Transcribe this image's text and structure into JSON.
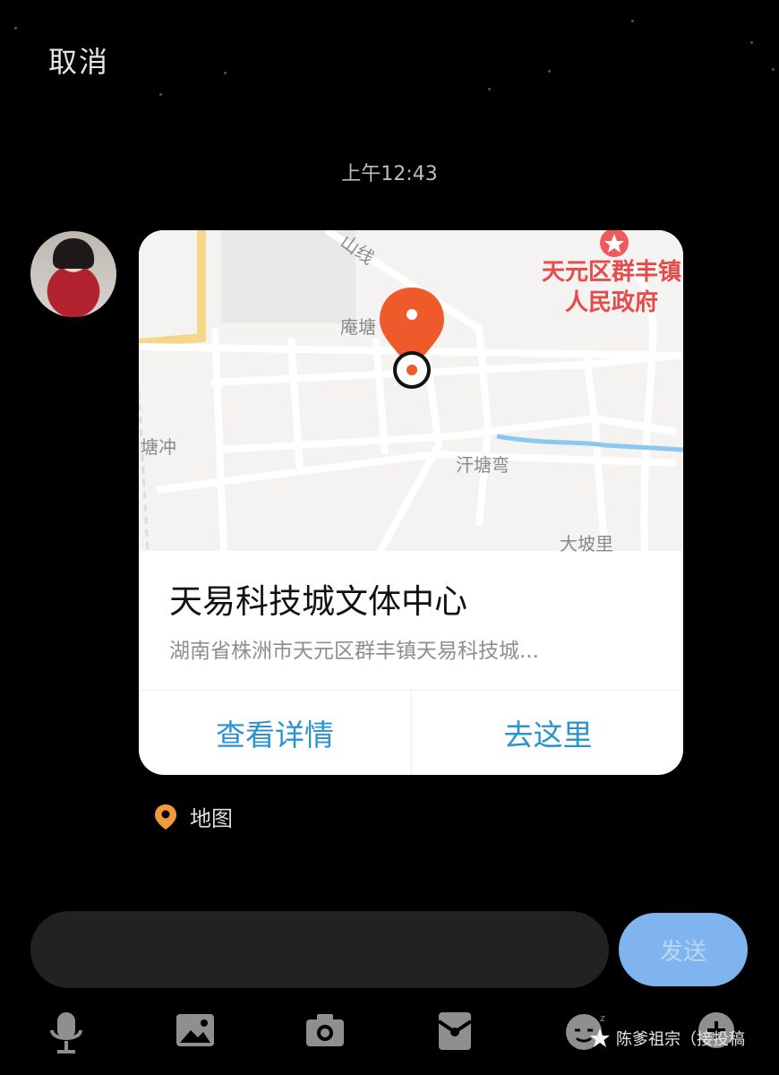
{
  "header": {
    "cancel_label": "取消"
  },
  "chat": {
    "timestamp": "上午12:43",
    "location_card": {
      "map_labels": {
        "road": "山线",
        "area_1": "庵塘",
        "area_2": "塘冲",
        "area_3": "汗塘弯",
        "area_4": "大坡里",
        "poi_line1": "天元区群丰镇",
        "poi_line2": "人民政府"
      },
      "title": "天易科技城文体中心",
      "address": "湖南省株洲市天元区群丰镇天易科技城...",
      "actions": {
        "details": "查看详情",
        "navigate": "去这里"
      }
    },
    "source_label": "地图"
  },
  "composer": {
    "input_value": "",
    "send_label": "发送"
  },
  "toolbar": {
    "icons": [
      "microphone-icon",
      "image-icon",
      "camera-icon",
      "red-packet-icon",
      "emoji-icon",
      "plus-icon"
    ]
  },
  "watermark": {
    "text": "陈爹祖宗（接投稿"
  },
  "colors": {
    "background": "#000000",
    "send_button": "#7fb4ef",
    "action_text": "#2a93cf",
    "map_pin": "#ef5a2a",
    "poi_text": "#e64b4b",
    "location_tag": "#f29a3b"
  }
}
